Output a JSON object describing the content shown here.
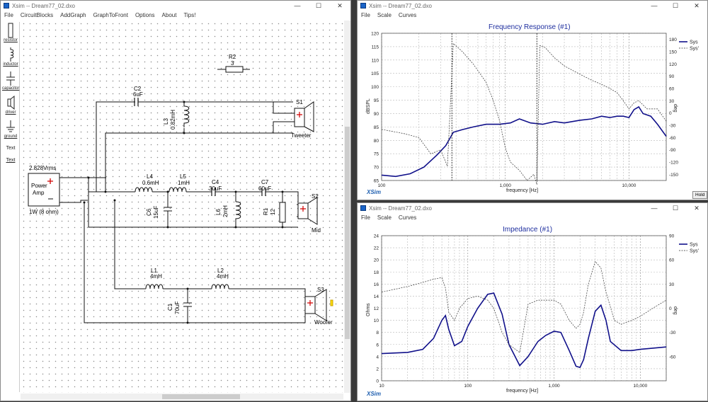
{
  "colors": {
    "sys": "#10108a",
    "sys_prev": "#333",
    "accent": "#1f2f9f",
    "speaker_plus": "#d00000"
  },
  "left_window": {
    "title": "Xsim -- Dream77_02.dxo",
    "controls": [
      "—",
      "☐",
      "✕"
    ],
    "menu": [
      "File",
      "CircuitBlocks",
      "AddGraph",
      "GraphToFront",
      "Options",
      "About",
      "Tips!"
    ],
    "toolbox": [
      {
        "label": "resistor",
        "icon": "resistor-icon"
      },
      {
        "label": "inductor",
        "icon": "inductor-icon"
      },
      {
        "label": "capacitor",
        "icon": "capacitor-icon"
      },
      {
        "label": "driver",
        "icon": "driver-icon"
      },
      {
        "label": "ground",
        "icon": "ground-icon"
      }
    ],
    "toolbox_text": [
      "Text",
      "Text"
    ],
    "circuit": {
      "source": {
        "voltage": "2.828Vrms",
        "name": "Power\nAmp",
        "name_l1": "Power",
        "name_l2": "Amp",
        "power": "1W (8 ohm)"
      },
      "R2": {
        "name": "R2",
        "value": "3"
      },
      "C2": {
        "name": "C2",
        "value": "6uF"
      },
      "L3": {
        "name": "L3",
        "value": "0.82mH"
      },
      "S1": {
        "name": "S1",
        "type": "Tweeter"
      },
      "L4": {
        "name": "L4",
        "value": "0.6mH"
      },
      "L5": {
        "name": "L5",
        "value": "1mH"
      },
      "C4": {
        "name": "C4",
        "value": "30uF"
      },
      "C7": {
        "name": "C7",
        "value": "60uF"
      },
      "C6": {
        "name": "C6",
        "value": "15uF"
      },
      "L6": {
        "name": "L6",
        "value": "2mH"
      },
      "R1": {
        "name": "R1",
        "value": "12"
      },
      "S2": {
        "name": "S2",
        "type": "Mid"
      },
      "L1": {
        "name": "L1",
        "value": "4mH"
      },
      "L2": {
        "name": "L2",
        "value": "4mH"
      },
      "C1": {
        "name": "C1",
        "value": "70uF"
      },
      "S3": {
        "name": "S3",
        "type": "Woofer"
      }
    }
  },
  "freq_window": {
    "title": "Xsim -- Dream77_02.dxo",
    "controls": [
      "—",
      "☐",
      "✕"
    ],
    "menu": [
      "File",
      "Scale",
      "Curves"
    ],
    "hold": "Hold",
    "brand": "XSim"
  },
  "imp_window": {
    "title": "Xsim -- Dream77_02.dxo",
    "controls": [
      "—",
      "☐",
      "✕"
    ],
    "menu": [
      "File",
      "Scale",
      "Curves"
    ],
    "brand": "XSim"
  },
  "chart_data": [
    {
      "type": "line",
      "title": "Frequency Response (#1)",
      "xlabel": "frequency [Hz]",
      "ylabel": "dBSPL",
      "ylabel_right": "deg",
      "x_scale": "log",
      "xlim": [
        100,
        20000
      ],
      "ylim": [
        65,
        120
      ],
      "ylim_right": [
        -165,
        195
      ],
      "x_ticks": [
        "100",
        "1,000",
        "10,000"
      ],
      "y_ticks": [
        "120",
        "115",
        "110",
        "105",
        "100",
        "95",
        "90",
        "85",
        "80",
        "75",
        "70",
        "65"
      ],
      "y_right_ticks": [
        "180",
        "150",
        "120",
        "90",
        "60",
        "30",
        "0",
        "-30",
        "-60",
        "-90",
        "-120",
        "-150"
      ],
      "grid": true,
      "legend": "top-right",
      "series": [
        {
          "name": "Sys",
          "axis": "left",
          "style": "solid",
          "x": [
            100,
            130,
            170,
            220,
            280,
            330,
            380,
            450,
            550,
            700,
            900,
            1100,
            1300,
            1600,
            2000,
            2500,
            3000,
            4000,
            5000,
            6000,
            7000,
            8000,
            9000,
            10000,
            11000,
            12000,
            13000,
            15000,
            17000,
            20000
          ],
          "y": [
            67,
            66.5,
            67.5,
            70,
            74.5,
            78,
            83,
            84,
            85,
            86,
            86,
            86.5,
            88,
            86.5,
            86,
            87,
            86.5,
            87.5,
            88,
            89,
            88.5,
            89,
            89,
            88.5,
            91.5,
            92.5,
            90,
            89,
            86,
            81.5
          ]
        },
        {
          "name": "Sys'",
          "axis": "right",
          "style": "dashed",
          "x": [
            100,
            150,
            200,
            250,
            300,
            340,
            380,
            450,
            550,
            700,
            800,
            900,
            1000,
            1100,
            1300,
            1500,
            1700,
            1800,
            1900,
            2100,
            2500,
            3000,
            4000,
            5000,
            6000,
            7000,
            8000,
            9000,
            10000,
            11000,
            12000,
            14000,
            17000,
            20000
          ],
          "y": [
            -40,
            -50,
            -60,
            -100,
            -90,
            -130,
            170,
            150,
            120,
            75,
            30,
            -20,
            -85,
            -120,
            -140,
            -165,
            -150,
            -175,
            165,
            160,
            135,
            115,
            95,
            80,
            70,
            60,
            50,
            30,
            10,
            25,
            30,
            10,
            10,
            -20
          ]
        }
      ]
    },
    {
      "type": "line",
      "title": "Impedance (#1)",
      "xlabel": "frequency [Hz]",
      "ylabel": "Ohms",
      "ylabel_right": "deg",
      "x_scale": "log",
      "xlim": [
        10,
        20000
      ],
      "ylim": [
        0,
        24
      ],
      "ylim_right": [
        -90,
        90
      ],
      "x_ticks": [
        "10",
        "100",
        "1,000",
        "10,000"
      ],
      "y_ticks": [
        "24",
        "22",
        "20",
        "18",
        "16",
        "14",
        "12",
        "10",
        "8",
        "6",
        "4",
        "2",
        "0"
      ],
      "y_right_ticks": [
        "90",
        "60",
        "30",
        "0",
        "-30",
        "-60"
      ],
      "grid": true,
      "legend": "top-right",
      "series": [
        {
          "name": "Sys",
          "axis": "left",
          "style": "solid",
          "x": [
            10,
            20,
            30,
            40,
            50,
            55,
            60,
            70,
            85,
            100,
            130,
            170,
            200,
            250,
            300,
            400,
            500,
            650,
            800,
            1000,
            1200,
            1500,
            1800,
            2000,
            2200,
            2500,
            3000,
            3500,
            4000,
            4500,
            6000,
            8000,
            10000,
            14000,
            20000
          ],
          "y": [
            4.5,
            4.7,
            5.2,
            7,
            10,
            10.8,
            8.5,
            5.8,
            6.5,
            9,
            12,
            14.3,
            14.5,
            11,
            6,
            2.5,
            4,
            6.5,
            7.5,
            8.2,
            8,
            5,
            2.4,
            2.2,
            3.5,
            7,
            11.5,
            12.5,
            10,
            6.5,
            5,
            5,
            5.2,
            5.4,
            5.6
          ]
        },
        {
          "name": "Sys'",
          "axis": "right",
          "style": "dashed",
          "x": [
            10,
            20,
            30,
            40,
            50,
            55,
            60,
            70,
            80,
            100,
            130,
            170,
            200,
            250,
            300,
            400,
            500,
            650,
            800,
            1000,
            1200,
            1500,
            1800,
            2000,
            2200,
            2500,
            3000,
            3500,
            4000,
            5000,
            6000,
            8000,
            10000,
            14000,
            20000
          ],
          "y": [
            20,
            27,
            32,
            36,
            38,
            25,
            -5,
            -15,
            0,
            12,
            15,
            10,
            0,
            -30,
            -45,
            -55,
            5,
            10,
            10,
            10,
            5,
            -15,
            -25,
            -20,
            -5,
            30,
            58,
            50,
            20,
            -15,
            -20,
            -15,
            -10,
            0,
            10
          ]
        }
      ]
    }
  ]
}
